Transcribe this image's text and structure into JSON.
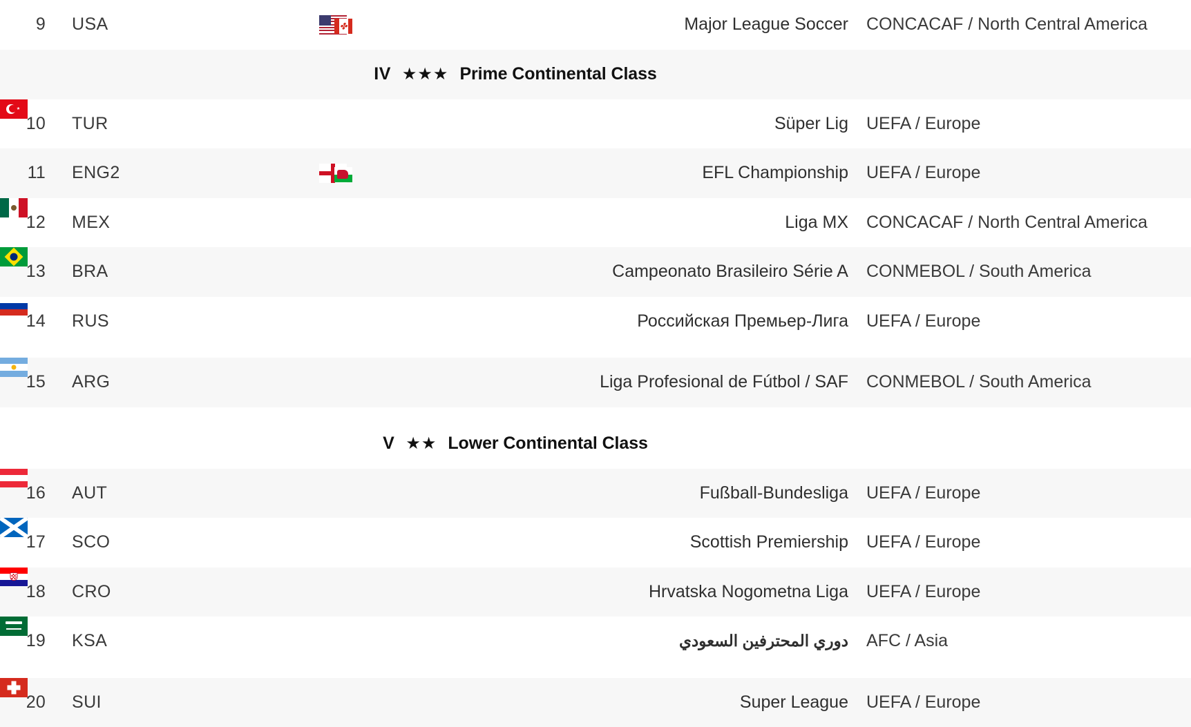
{
  "table": {
    "columns": [
      "rank",
      "code",
      "flag",
      "league",
      "confederation"
    ],
    "rows": [
      {
        "kind": "data",
        "rank": "9",
        "code": "USA",
        "flag": "flag-usa-canada",
        "league": "Major League Soccer",
        "confederation": "CONCACAF / North Central America",
        "stripe": false
      },
      {
        "kind": "section",
        "numeral": "IV",
        "stars": "★★★",
        "star_count": 3,
        "title": "Prime Continental Class",
        "stripe": true
      },
      {
        "kind": "data",
        "rank": "10",
        "code": "TUR",
        "flag": "flag-turkey",
        "league": "Süper Lig",
        "confederation": "UEFA / Europe",
        "stripe": false
      },
      {
        "kind": "data",
        "rank": "11",
        "code": "ENG2",
        "flag": "flag-england-wales",
        "league": "EFL Championship",
        "confederation": "UEFA / Europe",
        "stripe": true
      },
      {
        "kind": "data",
        "rank": "12",
        "code": "MEX",
        "flag": "flag-mexico",
        "league": "Liga MX",
        "confederation": "CONCACAF / North Central America",
        "stripe": false
      },
      {
        "kind": "data",
        "rank": "13",
        "code": "BRA",
        "flag": "flag-brazil",
        "league": "Campeonato Brasileiro Série A",
        "confederation": "CONMEBOL / South America",
        "stripe": true
      },
      {
        "kind": "data",
        "rank": "14",
        "code": "RUS",
        "flag": "flag-russia",
        "league": "Российская Премьер-Лига",
        "confederation": "UEFA / Europe",
        "stripe": false
      },
      {
        "kind": "data",
        "rank": "15",
        "code": "ARG",
        "flag": "flag-argentina",
        "league": "Liga Profesional de Fútbol / SAF",
        "confederation": "CONMEBOL / South America",
        "stripe": true
      },
      {
        "kind": "section",
        "numeral": "V",
        "stars": "★★",
        "star_count": 2,
        "title": "Lower Continental Class",
        "stripe": false
      },
      {
        "kind": "data",
        "rank": "16",
        "code": "AUT",
        "flag": "flag-austria",
        "league": "Fußball-Bundesliga",
        "confederation": "UEFA / Europe",
        "stripe": true
      },
      {
        "kind": "data",
        "rank": "17",
        "code": "SCO",
        "flag": "flag-scotland",
        "league": "Scottish Premiership",
        "confederation": "UEFA / Europe",
        "stripe": false
      },
      {
        "kind": "data",
        "rank": "18",
        "code": "CRO",
        "flag": "flag-croatia",
        "league": "Hrvatska Nogometna Liga",
        "confederation": "UEFA / Europe",
        "stripe": true
      },
      {
        "kind": "data",
        "rank": "19",
        "code": "KSA",
        "flag": "flag-saudi-arabia",
        "league": "دوري المحترفين السعودي",
        "confederation": "AFC / Asia",
        "stripe": false
      },
      {
        "kind": "data",
        "rank": "20",
        "code": "SUI",
        "flag": "flag-switzerland",
        "league": "Super League",
        "confederation": "UEFA / Europe",
        "stripe": true
      }
    ]
  },
  "colors": {
    "stripe_background": "#f7f7f7",
    "plain_background": "#ffffff",
    "body_text": "#3a3a3a",
    "header_text": "#111111"
  }
}
